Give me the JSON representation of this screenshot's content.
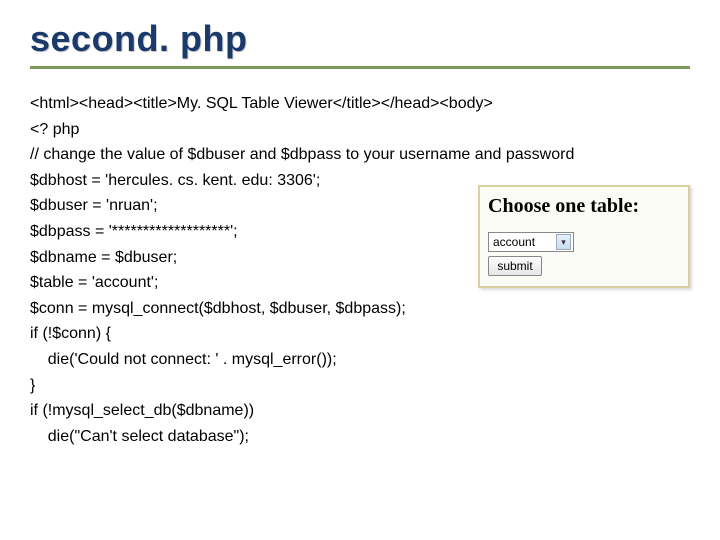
{
  "title": "second. php",
  "code_lines": [
    "<html><head><title>My. SQL Table Viewer</title></head><body>",
    "<? php",
    "// change the value of $dbuser and $dbpass to your username and password",
    "$dbhost = 'hercules. cs. kent. edu: 3306';",
    "$dbuser = 'nruan';",
    "$dbpass = '*******************';",
    "$dbname = $dbuser;",
    "$table = 'account';",
    "$conn = mysql_connect($dbhost, $dbuser, $dbpass);",
    "if (!$conn) {",
    "    die('Could not connect: ' . mysql_error());",
    "}",
    "if (!mysql_select_db($dbname))",
    "    die(\"Can't select database\");"
  ],
  "inset": {
    "heading": "Choose one table:",
    "select_value": "account",
    "submit_label": "submit"
  }
}
